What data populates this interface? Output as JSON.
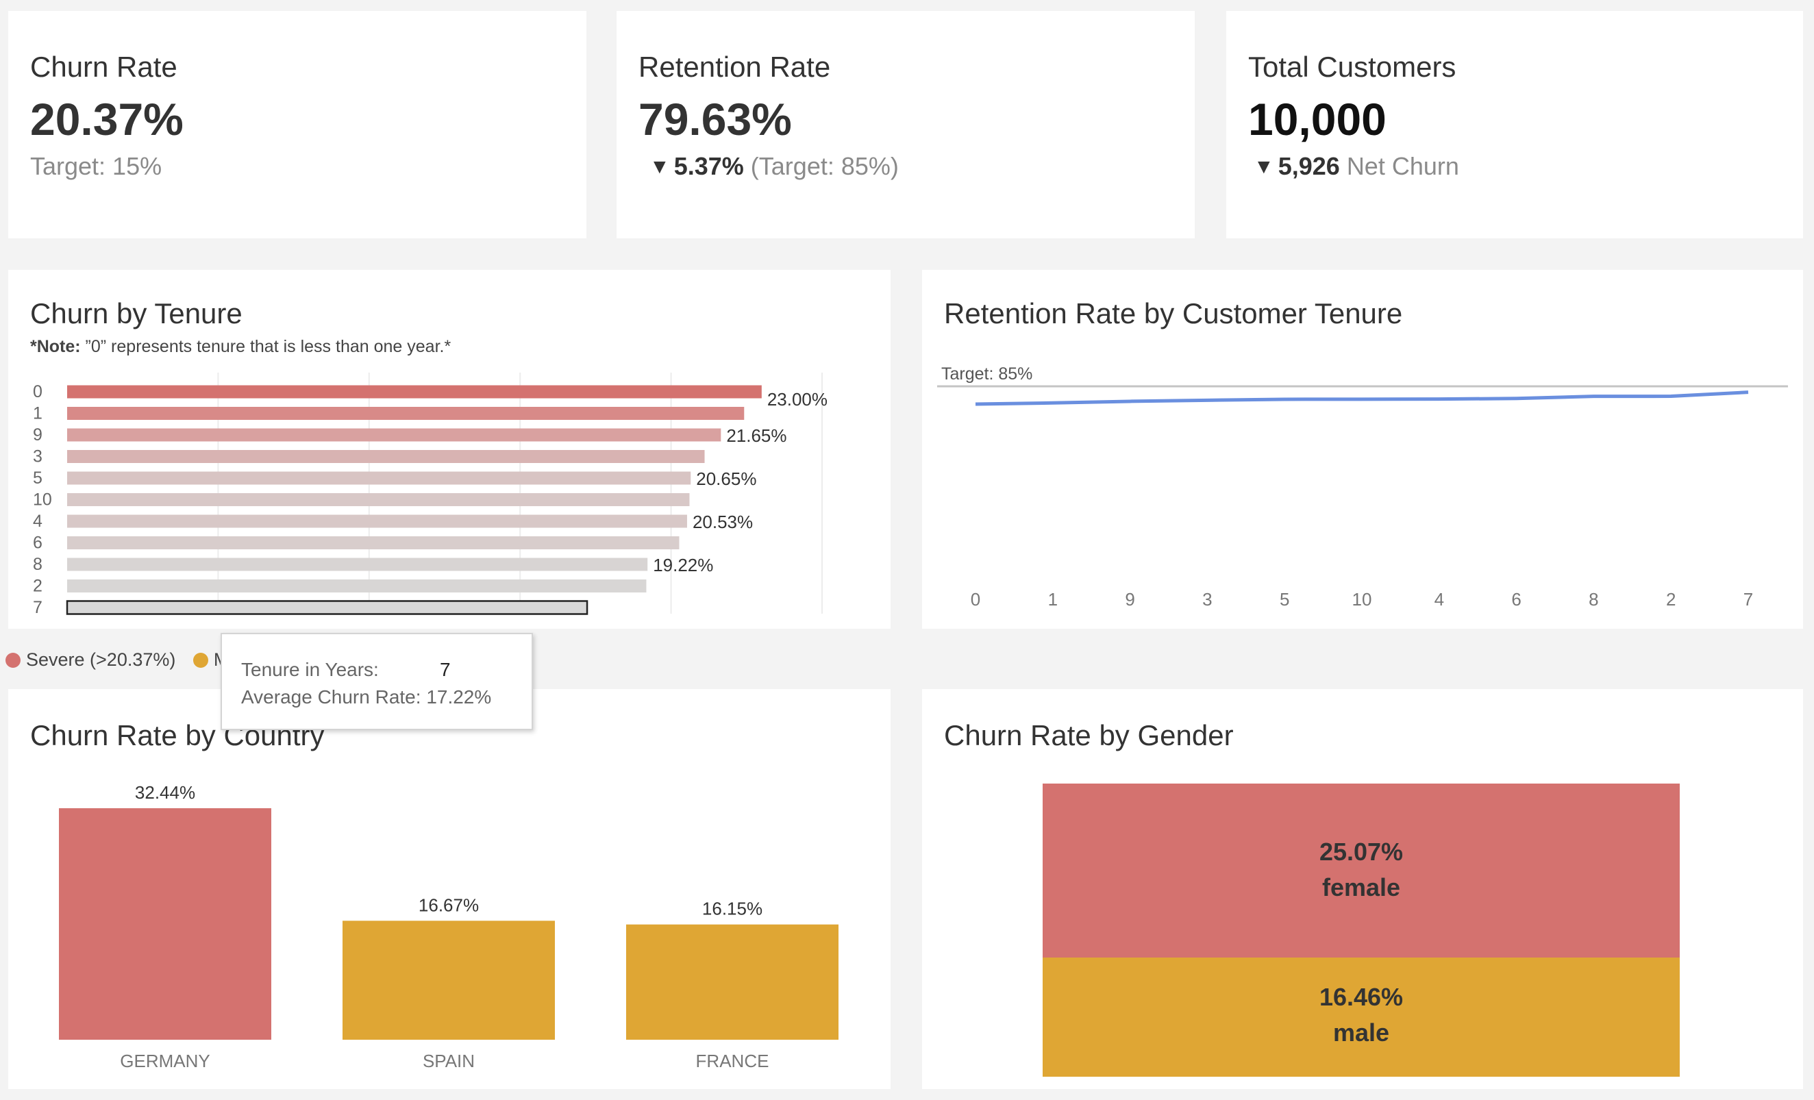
{
  "kpis": {
    "churn": {
      "title": "Churn Rate",
      "value": "20.37%",
      "sub": "Target: 15%"
    },
    "retention": {
      "title": "Retention Rate",
      "value": "79.63%",
      "delta": "5.37%",
      "sub": "(Target: 85%)"
    },
    "customers": {
      "title": "Total Customers",
      "value": "10,000",
      "delta": "5,926",
      "sub": "Net Churn"
    }
  },
  "tenure_panel": {
    "title": "Churn by Tenure",
    "note_bold": "*Note:",
    "note_text": " ”0” represents tenure that is less than one year.*"
  },
  "retention_panel": {
    "title": "Retention Rate by Customer Tenure",
    "target_label": "Target: 85%"
  },
  "country_panel": {
    "title": "Churn Rate by Country"
  },
  "gender_panel": {
    "title": "Churn Rate by Gender"
  },
  "legend": {
    "items": [
      {
        "label": "Severe (>20.37%)",
        "color": "#d4726f"
      },
      {
        "label": "M",
        "color": "#dfa634"
      }
    ]
  },
  "tooltip": {
    "label1": "Tenure in Years:",
    "value1": "7",
    "label2": "Average Churn Rate:",
    "value2": "17.22%"
  },
  "colors": {
    "severe": "#d4726f",
    "moderate": "#dfa634",
    "line": "#6a8fdf",
    "target_line": "#c4c4c4"
  },
  "chart_data": [
    {
      "type": "bar",
      "orientation": "horizontal",
      "title": "Churn by Tenure",
      "categories": [
        "0",
        "1",
        "9",
        "3",
        "5",
        "10",
        "4",
        "6",
        "8",
        "2",
        "7"
      ],
      "values": [
        23.0,
        22.42,
        21.65,
        21.11,
        20.65,
        20.61,
        20.53,
        20.27,
        19.22,
        19.18,
        17.22
      ],
      "labels": [
        "23.00%",
        "",
        "21.65%",
        "",
        "20.65%",
        "",
        "20.53%",
        "",
        "19.22%",
        "",
        ""
      ],
      "colors": [
        "#d4726f",
        "#d88a88",
        "#d9a1a0",
        "#d8b3b2",
        "#d8c4c3",
        "#d8c8c7",
        "#d8c8c7",
        "#d8cdcc",
        "#d8d4d3",
        "#d8d6d5",
        "#d8d8d8"
      ],
      "xlim": [
        0,
        25
      ],
      "gridlines": [
        5,
        10,
        15,
        20,
        25
      ],
      "highlighted": "7"
    },
    {
      "type": "line",
      "title": "Retention Rate by Customer Tenure",
      "categories": [
        "0",
        "1",
        "9",
        "3",
        "5",
        "10",
        "4",
        "6",
        "8",
        "2",
        "7"
      ],
      "values": [
        77.0,
        77.58,
        78.35,
        78.89,
        79.35,
        79.39,
        79.47,
        79.73,
        80.78,
        80.82,
        82.78
      ],
      "target": 85,
      "ylim": [
        0,
        88
      ]
    },
    {
      "type": "bar",
      "title": "Churn Rate by Country",
      "categories": [
        "GERMANY",
        "SPAIN",
        "FRANCE"
      ],
      "values": [
        32.44,
        16.67,
        16.15
      ],
      "labels": [
        "32.44%",
        "16.67%",
        "16.15%"
      ],
      "colors": [
        "#d4726f",
        "#dfa634",
        "#dfa634"
      ],
      "ylim": [
        0,
        34
      ]
    },
    {
      "type": "heatmap",
      "title": "Churn Rate by Gender",
      "categories": [
        "female",
        "male"
      ],
      "values": [
        25.07,
        16.46
      ],
      "labels": [
        "25.07%",
        "16.46%"
      ],
      "colors": [
        "#d4726f",
        "#dfa634"
      ]
    }
  ]
}
